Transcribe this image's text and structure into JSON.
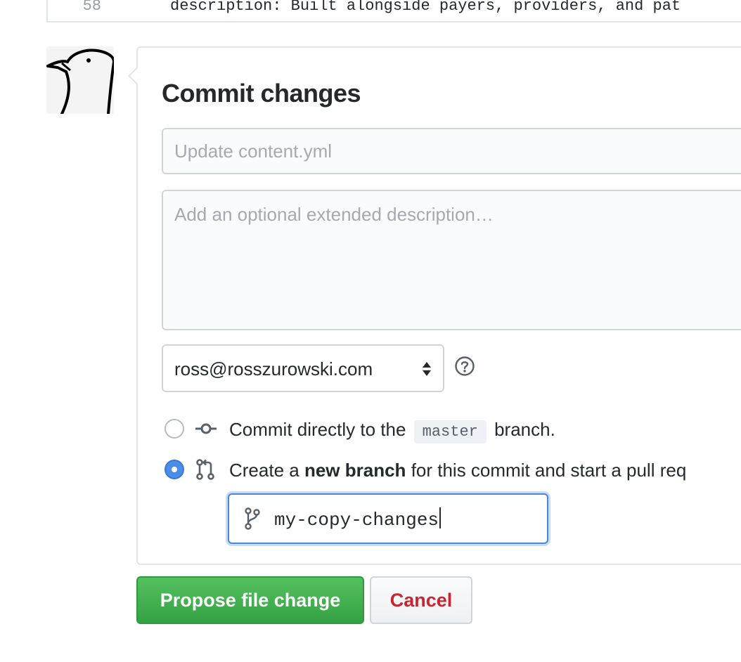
{
  "code_line": {
    "number": "58",
    "text": "description: Built alongside payers, providers, and pat"
  },
  "avatar": {
    "name": "user-avatar"
  },
  "commit": {
    "title": "Commit changes",
    "summary_placeholder": "Update content.yml",
    "description_placeholder": "Add an optional extended description…",
    "email": "ross@rosszurowski.com",
    "options": {
      "direct_prefix": "Commit directly to the",
      "direct_branch": "master",
      "direct_suffix": "branch.",
      "new_prefix": "Create a",
      "new_bold": "new branch",
      "new_suffix": "for this commit and start a pull req",
      "selected": "new-branch"
    },
    "branch_name": "my-copy-changes"
  },
  "buttons": {
    "propose": "Propose file change",
    "cancel": "Cancel"
  },
  "colors": {
    "primary_green": "#34a244",
    "cancel_red": "#cb2431",
    "radio_blue": "#4c8de6",
    "focus_blue": "#4b86d7"
  },
  "icons": {
    "help": "question-circle-icon",
    "commit": "git-commit-icon",
    "pull_request": "git-pull-request-icon",
    "branch": "git-branch-icon",
    "select": "select-arrows-icon"
  }
}
